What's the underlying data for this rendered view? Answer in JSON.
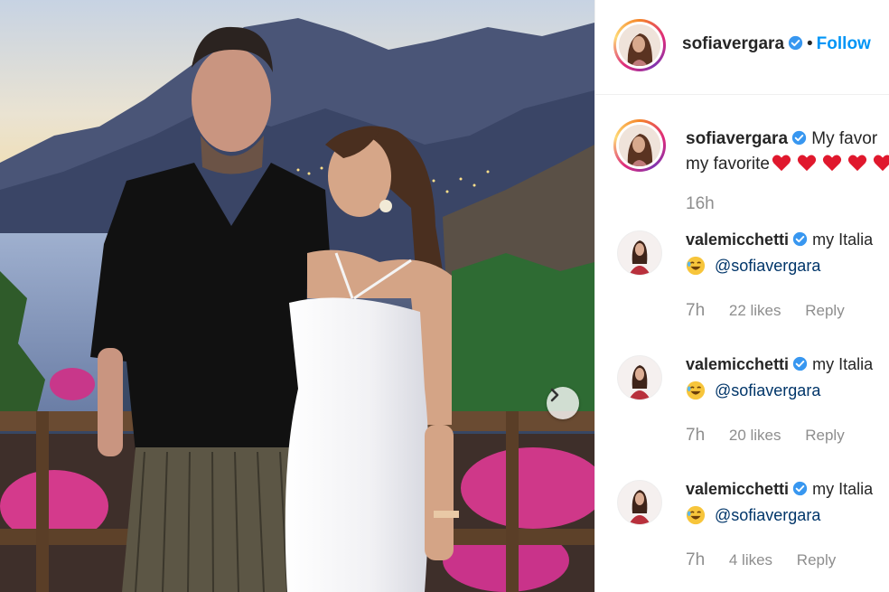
{
  "post": {
    "username": "sofiavergara",
    "separator": "•",
    "follow_label": "Follow",
    "caption_start": "My favor",
    "caption_line2": "my favorite",
    "caption_hearts": 5,
    "time": "16h"
  },
  "comments": [
    {
      "username": "valemicchetti",
      "text": "my Italia",
      "emoji": "rolling-on-floor-laughing",
      "mention": "@sofiavergara",
      "time": "7h",
      "likes": "22 likes",
      "reply": "Reply"
    },
    {
      "username": "valemicchetti",
      "text": "my Italia",
      "emoji": "rolling-on-floor-laughing",
      "mention": "@sofiavergara",
      "time": "7h",
      "likes": "20 likes",
      "reply": "Reply"
    },
    {
      "username": "valemicchetti",
      "text": "my Italia",
      "emoji": "rolling-on-floor-laughing",
      "mention": "@sofiavergara",
      "time": "7h",
      "likes": "4 likes",
      "reply": "Reply"
    }
  ],
  "icons": {
    "verified": "verified-badge-icon",
    "next": "chevron-right-icon",
    "heart": "red-heart-icon",
    "laugh": "laughing-emoji-icon"
  },
  "colors": {
    "link_blue": "#0095f6",
    "verified_blue": "#3897f0",
    "heart_red": "#e0182d",
    "text_dark": "#262626",
    "text_muted": "#8e8e8e"
  }
}
